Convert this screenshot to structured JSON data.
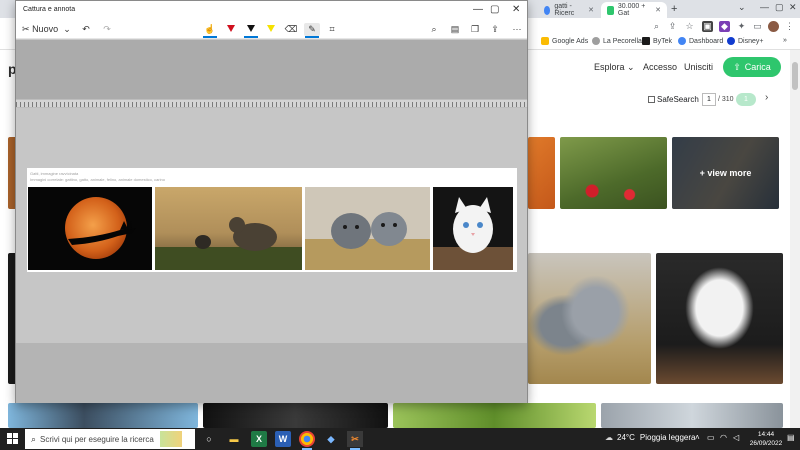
{
  "browser": {
    "tabs": [
      {
        "label": "gatti - Ricerc",
        "active": false,
        "favicon_color": "#4285f4"
      },
      {
        "label": "30.000 + Gat",
        "active": true,
        "favicon_color": "#2ec66d"
      }
    ],
    "bookmarks": [
      "Google Ads",
      "La Pecorella",
      "ByTek",
      "Dashboard",
      "Disney+"
    ],
    "site": {
      "logo": "p",
      "nav": [
        "Esplora",
        "Accesso",
        "Unisciti"
      ],
      "upload_label": "Carica",
      "safesearch_label": "SafeSearch",
      "page_current": "1",
      "page_total": "/ 310",
      "page_button": "1",
      "view_more": "+ view more"
    }
  },
  "snip": {
    "title": "Cattura e annota",
    "new_label": "Nuovo",
    "tools": [
      "touch-writing-icon",
      "ballpoint-pen-icon",
      "pencil-icon",
      "highlighter-icon",
      "eraser-icon",
      "ruler-icon",
      "crop-icon"
    ],
    "actions": [
      "zoom-icon",
      "save-icon",
      "copy-icon",
      "share-icon",
      "more-icon"
    ],
    "captured_line1": "Gatti, immagine ravvicinata",
    "captured_line2": "Immagini correlate: gattino, gatto, animale, felino, animale domestico, carino"
  },
  "taskbar": {
    "search_placeholder": "Scrivi qui per eseguire la ricerca",
    "temperature": "24°C",
    "weather_text": "Pioggia leggera",
    "time": "14:44",
    "date": "26/09/2022"
  },
  "colors": {
    "accent_green": "#2ec66d",
    "windows_blue": "#0078d7",
    "taskbar": "#202020"
  }
}
